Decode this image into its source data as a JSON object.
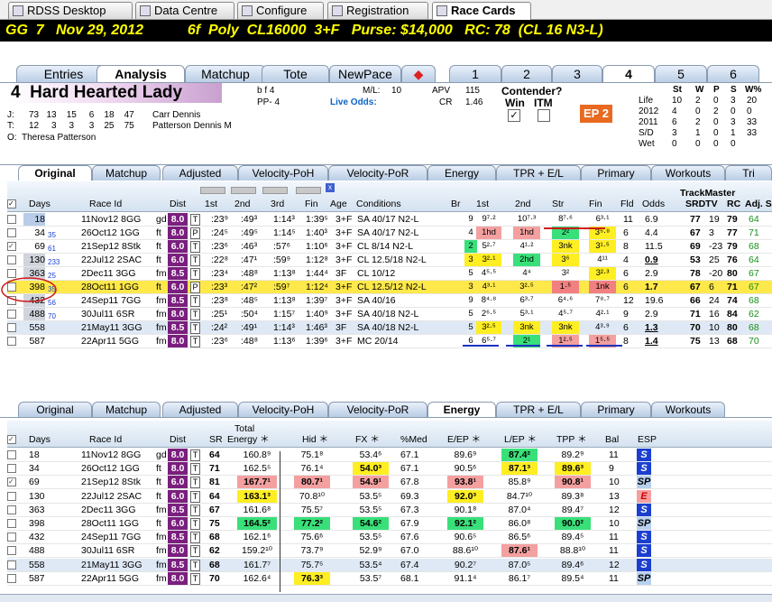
{
  "top_tabs": [
    {
      "label": "RDSS Desktop"
    },
    {
      "label": "Data Centre"
    },
    {
      "label": "Configure"
    },
    {
      "label": "Registration"
    },
    {
      "label": "Race Cards"
    }
  ],
  "race_header": {
    "text": "GG  7   Nov 29, 2012           6f  Poly  CL16000  3+F   Purse: $14,000   RC: 78  (CL 16 N3-L)"
  },
  "view_tabs": [
    "Entries",
    "Analysis",
    "Matchup",
    "Tote",
    "NewPace"
  ],
  "horse_tabs": [
    "1",
    "2",
    "3",
    "4",
    "5",
    "6"
  ],
  "horse": {
    "number": "4",
    "name": "Hard Hearted Lady",
    "sex_age": "b f 4",
    "pp": "PP- 4",
    "ml_label": "M/L:",
    "ml": "10",
    "apv_label": "APV",
    "apv": "115",
    "live_odds_label": "Live Odds:",
    "cr_label": "CR",
    "cr": "1.46",
    "contender_label": "Contender?",
    "win_label": "Win",
    "itm_label": "ITM",
    "ep_label": "EP 2",
    "connections": [
      {
        "role": "J:",
        "stats": "73   13    15     6    18    47",
        "name": "Carr Dennis"
      },
      {
        "role": "T:",
        "stats": "12     3     3      3    25    75",
        "name": "Patterson Dennis M"
      },
      {
        "role": "O:",
        "stats": "",
        "name": "Theresa Patterson"
      }
    ]
  },
  "record": {
    "headers": [
      "St",
      "W",
      "P",
      "S",
      "W%"
    ],
    "rows": [
      {
        "label": "Life",
        "vals": [
          "10",
          "2",
          "0",
          "3",
          "20"
        ]
      },
      {
        "label": "2012",
        "vals": [
          "4",
          "0",
          "2",
          "0",
          "0"
        ]
      },
      {
        "label": "2011",
        "vals": [
          "6",
          "2",
          "0",
          "3",
          "33"
        ]
      },
      {
        "label": "S/D",
        "vals": [
          "3",
          "1",
          "0",
          "1",
          "33"
        ]
      },
      {
        "label": "Wet",
        "vals": [
          "0",
          "0",
          "0",
          "0",
          ""
        ]
      }
    ]
  },
  "pp_tabs": [
    "Original",
    "Matchup",
    "Adjusted",
    "Velocity-PoH",
    "Velocity-PoR",
    "Energy",
    "TPR + E/L",
    "Primary",
    "Workouts",
    "Tri"
  ],
  "pp_headers": {
    "days": "Days",
    "raceid": "Race Id",
    "dist": "Dist",
    "c1": "1st",
    "c2": "2nd",
    "c3": "3rd",
    "fin": "Fin",
    "age": "Age",
    "cond": "Conditions",
    "br": "Br",
    "c1b": "1st",
    "c2b": "2nd",
    "str": "Str",
    "finb": "Fin",
    "fld": "Fld",
    "odds": "Odds",
    "tm": "TrackMaster",
    "srdtv": "SRDTV",
    "rc": "RC",
    "adj": "Adj. S"
  },
  "pp_rows": [
    {
      "n": "1",
      "days": "18",
      "dayssub": "",
      "raceid": "11Nov12 8GG",
      "surf": "gd",
      "dist": "8.0",
      "tag": "T",
      "c1": ":23⁹",
      "c2": ":49³",
      "c3": "1:14³",
      "fin": "1:39⁵",
      "age": "3+F",
      "cond": "SA 40/17 N2-L",
      "br": "9",
      "b1": "9⁷·²",
      "b2": "10⁷·³",
      "bs": "8⁷·⁶",
      "bf": "6³·¹",
      "fld": "11",
      "odds": "6.9",
      "sr": "77",
      "dtv": "19",
      "rc": "79",
      "adj": "64"
    },
    {
      "n": "2",
      "days": "34",
      "dayssub": "35",
      "raceid": "26Oct12 1GG",
      "surf": "ft",
      "dist": "8.0",
      "tag": "P",
      "c1": ":24⁵",
      "c2": ":49⁵",
      "c3": "1:14⁵",
      "fin": "1:40³",
      "age": "3+F",
      "cond": "SA 40/17 N2-L",
      "br": "4",
      "b1": "1hd",
      "b2": "1hd",
      "bs": "2²",
      "bf": "3⁵·⁸",
      "fld": "6",
      "odds": "4.4",
      "sr": "67",
      "dtv": "3",
      "rc": "77",
      "adj": "71"
    },
    {
      "n": "3",
      "days": "69",
      "dayssub": "61",
      "raceid": "21Sep12 8Stk",
      "surf": "ft",
      "dist": "6.0",
      "tag": "T",
      "c1": ":23⁶",
      "c2": ":46³",
      "c3": ":57⁶",
      "fin": "1:10⁶",
      "age": "3+F",
      "cond": "CL 8/14 N2-L",
      "br": "2",
      "b1": "5²·⁷",
      "b2": "4¹·²",
      "bs": "3nk",
      "bf": "3¹·⁵",
      "fld": "8",
      "odds": "11.5",
      "sr": "69",
      "dtv": "-23",
      "rc": "79",
      "adj": "68"
    },
    {
      "n": "4",
      "days": "130",
      "dayssub": "233",
      "raceid": "22Jul12 2SAC",
      "surf": "ft",
      "dist": "6.0",
      "tag": "T",
      "c1": ":22⁸",
      "c2": ":47¹",
      "c3": ":59⁹",
      "fin": "1:12⁸",
      "age": "3+F",
      "cond": "CL 12.5/18 N2-L",
      "br": "3",
      "b1": "3²·¹",
      "b2": "2hd",
      "bs": "3⁶",
      "bf": "4¹¹",
      "fld": "4",
      "odds": "0.9",
      "sr": "53",
      "dtv": "25",
      "rc": "76",
      "adj": "64"
    },
    {
      "n": "5",
      "days": "363",
      "dayssub": "25",
      "raceid": "2Dec11 3GG",
      "surf": "fm",
      "dist": "8.5",
      "tag": "T",
      "c1": ":23⁴",
      "c2": ":48⁸",
      "c3": "1:13⁸",
      "fin": "1:44⁴",
      "age": "3F",
      "cond": "CL 10/12",
      "br": "5",
      "b1": "4⁵·⁵",
      "b2": "4⁴",
      "bs": "3²",
      "bf": "3²·³",
      "fld": "6",
      "odds": "2.9",
      "sr": "78",
      "dtv": "-20",
      "rc": "80",
      "adj": "67"
    },
    {
      "n": "6",
      "days": "398",
      "dayssub": "35",
      "raceid": "28Oct11 1GG",
      "surf": "ft",
      "dist": "6.0",
      "tag": "P",
      "c1": ":23³",
      "c2": ":47²",
      "c3": ":59⁷",
      "fin": "1:12⁴",
      "age": "3+F",
      "cond": "CL 12.5/12 N2-L",
      "br": "3",
      "b1": "4³·¹",
      "b2": "3²·⁵",
      "bs": "1·⁵",
      "bf": "1nk",
      "fld": "6",
      "odds": "1.7",
      "sr": "67",
      "dtv": "6",
      "rc": "71",
      "adj": "67"
    },
    {
      "n": "7",
      "days": "432",
      "dayssub": "56",
      "raceid": "24Sep11 7GG",
      "surf": "fm",
      "dist": "8.5",
      "tag": "T",
      "c1": ":23⁸",
      "c2": ":48⁵",
      "c3": "1:13⁸",
      "fin": "1:39⁷",
      "age": "3+F",
      "cond": "SA 40/16",
      "br": "9",
      "b1": "8⁴·⁸",
      "b2": "6³·⁷",
      "bs": "6⁴·⁶",
      "bf": "7⁸·⁷",
      "fld": "12",
      "odds": "19.6",
      "sr": "66",
      "dtv": "24",
      "rc": "74",
      "adj": "68"
    },
    {
      "n": "8",
      "days": "488",
      "dayssub": "70",
      "raceid": "30Jul11 6SR",
      "surf": "fm",
      "dist": "8.0",
      "tag": "T",
      "c1": ":25¹",
      "c2": ":50⁴",
      "c3": "1:15⁷",
      "fin": "1:40⁹",
      "age": "3+F",
      "cond": "SA 40/18 N2-L",
      "br": "5",
      "b1": "2⁶·⁵",
      "b2": "5³·¹",
      "bs": "4⁵·⁷",
      "bf": "4²·¹",
      "fld": "9",
      "odds": "2.9",
      "sr": "71",
      "dtv": "16",
      "rc": "84",
      "adj": "62"
    },
    {
      "n": "9",
      "days": "558",
      "dayssub": "",
      "raceid": "21May11 3GG",
      "surf": "fm",
      "dist": "8.5",
      "tag": "T",
      "c1": ":24²",
      "c2": ":49¹",
      "c3": "1:14³",
      "fin": "1:46³",
      "age": "3F",
      "cond": "SA 40/18 N2-L",
      "br": "5",
      "b1": "3²·⁵",
      "b2": "3nk",
      "bs": "3nk",
      "bf": "4³·⁹",
      "fld": "6",
      "odds": "1.3",
      "sr": "70",
      "dtv": "10",
      "rc": "80",
      "adj": "68"
    },
    {
      "n": "10",
      "days": "587",
      "dayssub": "",
      "raceid": "22Apr11 5GG",
      "surf": "fm",
      "dist": "8.0",
      "tag": "T",
      "c1": ":23⁶",
      "c2": ":48⁸",
      "c3": "1:13⁶",
      "fin": "1:39⁶",
      "age": "3+F",
      "cond": "MC 20/14",
      "br": "6",
      "b1": "6⁵·⁷",
      "b2": "2¹",
      "bs": "1²·⁵",
      "bf": "1⁵·⁵",
      "fld": "8",
      "odds": "1.4",
      "sr": "75",
      "dtv": "13",
      "rc": "68",
      "adj": "70"
    }
  ],
  "energy_tabs": [
    "Original",
    "Matchup",
    "Adjusted",
    "Velocity-PoH",
    "Velocity-PoR",
    "Energy",
    "TPR + E/L",
    "Primary",
    "Workouts"
  ],
  "energy_headers": {
    "days": "Days",
    "raceid": "Race Id",
    "dist": "Dist",
    "sr": "SR",
    "te1": "Total",
    "te2": "Energy ＊",
    "hid": "Hid ＊",
    "fx": "FX ＊",
    "med": "%Med",
    "eep": "E/EP ＊",
    "lep": "L/EP ＊",
    "tpp": "TPP ＊",
    "bal": "Bal",
    "esp": "ESP"
  },
  "energy_rows": [
    {
      "n": "1",
      "days": "18",
      "raceid": "11Nov12 8GG",
      "surf": "gd",
      "dist": "8.0",
      "sr": "64",
      "te": "160.8⁹",
      "hid": "75.1⁸",
      "fx": "53.4⁶",
      "med": "67.1",
      "eep": "89.6⁹",
      "lep": "87.4²",
      "tpp": "89.2⁹",
      "bal": "11",
      "esp": "S"
    },
    {
      "n": "2",
      "days": "34",
      "raceid": "26Oct12 1GG",
      "surf": "ft",
      "dist": "8.0",
      "sr": "71",
      "te": "162.5⁵",
      "hid": "76.1⁴",
      "fx": "54.0³",
      "med": "67.1",
      "eep": "90.5⁶",
      "lep": "87.1³",
      "tpp": "89.6³",
      "bal": "9",
      "esp": "S"
    },
    {
      "n": "3",
      "days": "69",
      "raceid": "21Sep12 8Stk",
      "surf": "ft",
      "dist": "6.0",
      "sr": "81",
      "te": "167.7¹",
      "hid": "80.7¹",
      "fx": "54.9¹",
      "med": "67.8",
      "eep": "93.8¹",
      "lep": "85.8⁹",
      "tpp": "90.8¹",
      "bal": "10",
      "esp": "SP"
    },
    {
      "n": "4",
      "days": "130",
      "raceid": "22Jul12 2SAC",
      "surf": "ft",
      "dist": "6.0",
      "sr": "64",
      "te": "163.1³",
      "hid": "70.8¹⁰",
      "fx": "53.5⁵",
      "med": "69.3",
      "eep": "92.0³",
      "lep": "84.7¹⁰",
      "tpp": "89.3⁸",
      "bal": "13",
      "esp": "E"
    },
    {
      "n": "5",
      "days": "363",
      "raceid": "2Dec11 3GG",
      "surf": "fm",
      "dist": "8.5",
      "sr": "67",
      "te": "161.6⁸",
      "hid": "75.5⁷",
      "fx": "53.5⁵",
      "med": "67.3",
      "eep": "90.1⁸",
      "lep": "87.0⁴",
      "tpp": "89.4⁷",
      "bal": "12",
      "esp": "S"
    },
    {
      "n": "6",
      "days": "398",
      "raceid": "28Oct11 1GG",
      "surf": "ft",
      "dist": "6.0",
      "sr": "75",
      "te": "164.5²",
      "hid": "77.2²",
      "fx": "54.6²",
      "med": "67.9",
      "eep": "92.1²",
      "lep": "86.0⁸",
      "tpp": "90.0²",
      "bal": "10",
      "esp": "SP"
    },
    {
      "n": "7",
      "days": "432",
      "raceid": "24Sep11 7GG",
      "surf": "fm",
      "dist": "8.5",
      "sr": "68",
      "te": "162.1⁶",
      "hid": "75.6⁶",
      "fx": "53.5⁵",
      "med": "67.6",
      "eep": "90.6⁵",
      "lep": "86.5⁶",
      "tpp": "89.4⁵",
      "bal": "11",
      "esp": "S"
    },
    {
      "n": "8",
      "days": "488",
      "raceid": "30Jul11 6SR",
      "surf": "fm",
      "dist": "8.0",
      "sr": "62",
      "te": "159.2¹⁰",
      "hid": "73.7⁹",
      "fx": "52.9⁹",
      "med": "67.0",
      "eep": "88.6¹⁰",
      "lep": "87.6¹",
      "tpp": "88.8¹⁰",
      "bal": "11",
      "esp": "S"
    },
    {
      "n": "9",
      "days": "558",
      "raceid": "21May11 3GG",
      "surf": "fm",
      "dist": "8.5",
      "sr": "68",
      "te": "161.7⁷",
      "hid": "75.7⁵",
      "fx": "53.5⁴",
      "med": "67.4",
      "eep": "90.2⁷",
      "lep": "87.0⁵",
      "tpp": "89.4⁶",
      "bal": "12",
      "esp": "S"
    },
    {
      "n": "10",
      "days": "587",
      "raceid": "22Apr11 5GG",
      "surf": "fm",
      "dist": "8.0",
      "sr": "70",
      "te": "162.6⁴",
      "hid": "76.3³",
      "fx": "53.5⁷",
      "med": "68.1",
      "eep": "91.1⁴",
      "lep": "86.1⁷",
      "tpp": "89.5⁴",
      "bal": "11",
      "esp": "SP"
    }
  ]
}
